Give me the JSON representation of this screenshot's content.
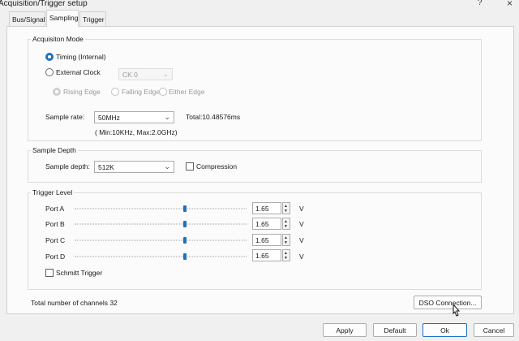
{
  "window": {
    "title": "Acquisition/Trigger setup",
    "help": "?",
    "close": "×"
  },
  "tabs": [
    {
      "label": "Bus/Signal"
    },
    {
      "label": "Sampling"
    },
    {
      "label": "Trigger"
    }
  ],
  "acquisition": {
    "title": "Acquisiton Mode",
    "timing_label": "Timing (Internal)",
    "external_label": "External Clock",
    "clock_value": "CK 0",
    "edges": [
      "Rising Edge",
      "Falling Edge",
      "Either Edge"
    ],
    "sample_rate_label": "Sample rate:",
    "sample_rate_value": "50MHz",
    "total_label": "Total:10.48576ms",
    "range_text": "( Min:10KHz, Max:2.0GHz)"
  },
  "depth": {
    "title": "Sample Depth",
    "label": "Sample depth:",
    "value": "512K",
    "compression_label": "Compression"
  },
  "trigger": {
    "title": "Trigger Level",
    "ports": [
      {
        "label": "Port A",
        "value": "1.65",
        "unit": "V"
      },
      {
        "label": "Port B",
        "value": "1.65",
        "unit": "V"
      },
      {
        "label": "Port C",
        "value": "1.65",
        "unit": "V"
      },
      {
        "label": "Port D",
        "value": "1.65",
        "unit": "V"
      }
    ],
    "schmitt_label": "Schmitt Trigger"
  },
  "footer": {
    "channels_text": "Total number of channels 32",
    "dso_label": "DSO Connection..."
  },
  "buttons": {
    "apply": "Apply",
    "default": "Default",
    "ok": "Ok",
    "cancel": "Cancel"
  }
}
